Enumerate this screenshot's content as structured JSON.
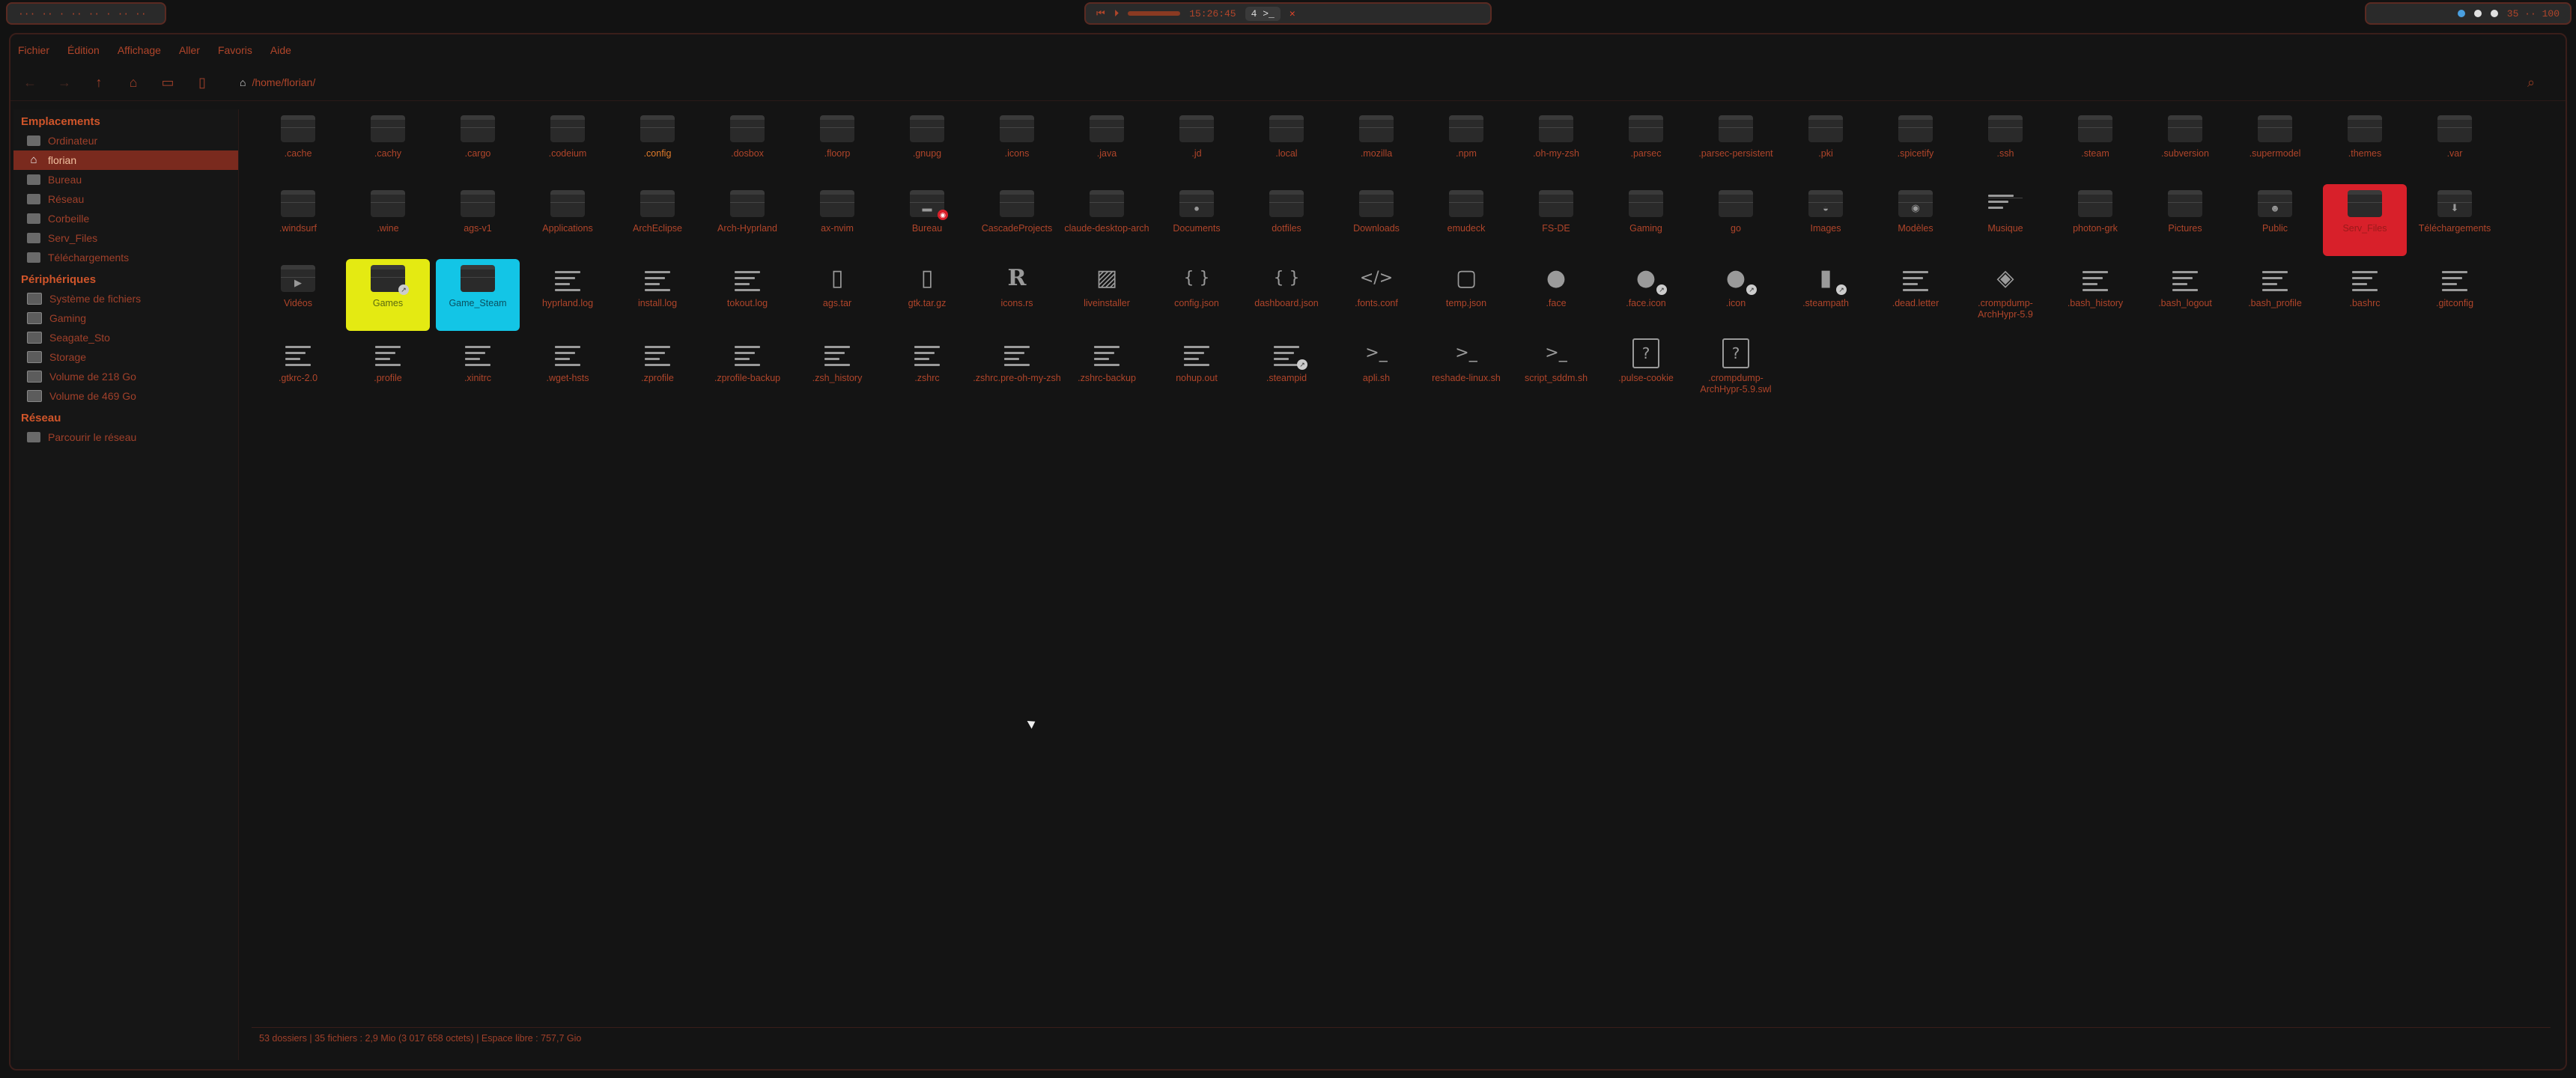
{
  "topbar": {
    "left_text": "··· ·· · ·· ·· · ·· ··",
    "center": {
      "workspace": "4 >_",
      "time": "15:26:45"
    },
    "right_text": "35 ·· 100"
  },
  "window": {
    "menu": [
      "Fichier",
      "Édition",
      "Affichage",
      "Aller",
      "Favoris",
      "Aide"
    ],
    "location": "/home/florian/"
  },
  "sidebar": {
    "sections": [
      {
        "title": "Emplacements",
        "items": [
          {
            "label": "Ordinateur",
            "icon": "computer-icon"
          },
          {
            "label": "florian",
            "icon": "home-icon",
            "active": true
          },
          {
            "label": "Bureau",
            "icon": "desktop-icon"
          },
          {
            "label": "Réseau",
            "icon": "network-icon"
          },
          {
            "label": "Corbeille",
            "icon": "trash-icon"
          },
          {
            "label": "Serv_Files",
            "icon": "folder-icon"
          },
          {
            "label": "Téléchargements",
            "icon": "download-icon"
          }
        ]
      },
      {
        "title": "Périphériques",
        "items": [
          {
            "label": "Système de fichiers",
            "icon": "drive-icon"
          },
          {
            "label": "Gaming",
            "icon": "drive-icon"
          },
          {
            "label": "Seagate_Sto",
            "icon": "drive-icon"
          },
          {
            "label": "Storage",
            "icon": "drive-icon"
          },
          {
            "label": "Volume de 218 Go",
            "icon": "drive-icon"
          },
          {
            "label": "Volume de 469 Go",
            "icon": "drive-icon"
          }
        ]
      },
      {
        "title": "Réseau",
        "items": [
          {
            "label": "Parcourir le réseau",
            "icon": "network-icon"
          }
        ]
      }
    ]
  },
  "files": [
    [
      ".cache",
      "folder"
    ],
    [
      ".cachy",
      "folder"
    ],
    [
      ".cargo",
      "folder"
    ],
    [
      ".codeium",
      "folder"
    ],
    [
      ".config",
      "folder",
      "bold"
    ],
    [
      ".dosbox",
      "folder"
    ],
    [
      ".floorp",
      "folder"
    ],
    [
      ".gnupg",
      "folder"
    ],
    [
      ".icons",
      "folder"
    ],
    [
      ".java",
      "folder"
    ],
    [
      ".jd",
      "folder"
    ],
    [
      ".local",
      "folder"
    ],
    [
      ".mozilla",
      "folder"
    ],
    [
      ".npm",
      "folder"
    ],
    [
      ".oh-my-zsh",
      "folder"
    ],
    [
      ".parsec",
      "folder"
    ],
    [
      ".parsec-persistent",
      "folder"
    ],
    [
      ".pki",
      "folder"
    ],
    [
      ".spicetify",
      "folder"
    ],
    [
      ".ssh",
      "folder"
    ],
    [
      ".steam",
      "folder"
    ],
    [
      ".subversion",
      "folder"
    ],
    [
      ".supermodel",
      "folder"
    ],
    [
      ".themes",
      "folder"
    ],
    [
      ".var",
      "folder"
    ],
    [
      ".windsurf",
      "folder"
    ],
    [
      ".wine",
      "folder"
    ],
    [
      "ags-v1",
      "folder"
    ],
    [
      "Applications",
      "folder"
    ],
    [
      "ArchEclipse",
      "folder"
    ],
    [
      "Arch-Hyprland",
      "folder"
    ],
    [
      "ax-nvim",
      "folder"
    ],
    [
      "Bureau",
      "desktop"
    ],
    [
      "CascadeProjects",
      "folder"
    ],
    [
      "claude-desktop-arch",
      "folder"
    ],
    [
      "Documents",
      "folder-doc"
    ],
    [
      "dotfiles",
      "folder"
    ],
    [
      "Downloads",
      "folder"
    ],
    [
      "emudeck",
      "folder"
    ],
    [
      "FS-DE",
      "folder"
    ],
    [
      "Gaming",
      "folder"
    ],
    [
      "go",
      "folder"
    ],
    [
      "Images",
      "folder-img"
    ],
    [
      "Modèles",
      "folder-tpl"
    ],
    [
      "Musique",
      "music"
    ],
    [
      "photon-grk",
      "folder"
    ],
    [
      "Pictures",
      "folder"
    ],
    [
      "Public",
      "folder-pub"
    ],
    [
      "Serv_Files",
      "folder",
      "sel-red"
    ],
    [
      "Téléchargements",
      "folder-dl"
    ],
    [
      "Vidéos",
      "folder-vid"
    ],
    [
      "Games",
      "folder-link",
      "sel-yellow"
    ],
    [
      "Game_Steam",
      "folder",
      "sel-cyan"
    ],
    [
      "hyprland.log",
      "text"
    ],
    [
      "install.log",
      "text"
    ],
    [
      "tokout.log",
      "text"
    ],
    [
      "ags.tar",
      "archive"
    ],
    [
      "gtk.tar.gz",
      "archive"
    ],
    [
      "icons.rs",
      "rust"
    ],
    [
      "liveinstaller",
      "image"
    ],
    [
      "config.json",
      "json"
    ],
    [
      "dashboard.json",
      "json"
    ],
    [
      ".fonts.conf",
      "code"
    ],
    [
      "temp.json",
      "blank"
    ],
    [
      ".face",
      "face"
    ],
    [
      ".face.icon",
      "face-link"
    ],
    [
      ".icon",
      "face-link"
    ],
    [
      ".steampath",
      "file-link"
    ],
    [
      ".dead.letter",
      "text"
    ],
    [
      ".crompdump-ArchHypr-5.9",
      "diamond"
    ],
    [
      ".bash_history",
      "text"
    ],
    [
      ".bash_logout",
      "text"
    ],
    [
      ".bash_profile",
      "text"
    ],
    [
      ".bashrc",
      "text"
    ],
    [
      ".gitconfig",
      "text"
    ],
    [
      ".gtkrc-2.0",
      "text"
    ],
    [
      ".profile",
      "text"
    ],
    [
      ".xinitrc",
      "text"
    ],
    [
      ".wget-hsts",
      "text"
    ],
    [
      ".zprofile",
      "text"
    ],
    [
      ".zprofile-backup",
      "text"
    ],
    [
      ".zsh_history",
      "text"
    ],
    [
      ".zshrc",
      "text"
    ],
    [
      ".zshrc.pre-oh-my-zsh",
      "text"
    ],
    [
      ".zshrc-backup",
      "text"
    ],
    [
      "nohup.out",
      "text"
    ],
    [
      ".steampid",
      "text-link"
    ],
    [
      "apli.sh",
      "script"
    ],
    [
      "reshade-linux.sh",
      "script"
    ],
    [
      "script_sddm.sh",
      "script"
    ],
    [
      ".pulse-cookie",
      "unknown"
    ],
    [
      ".crompdump-ArchHypr-5.9.swl",
      "unknown"
    ]
  ],
  "statusbar": {
    "text": "53 dossiers  |  35 fichiers : 2,9 Mio (3 017 658 octets)  |  Espace libre : 757,7 Gio"
  }
}
